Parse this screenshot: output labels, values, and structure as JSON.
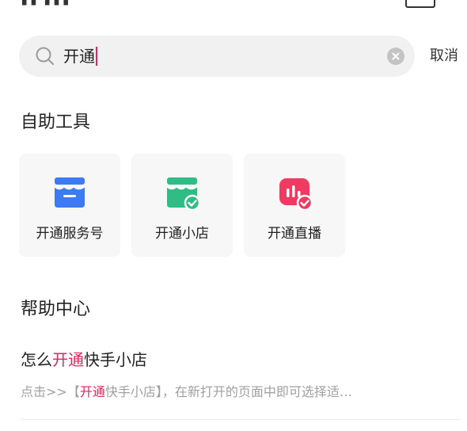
{
  "search": {
    "query": "开通",
    "cancel_label": "取消"
  },
  "tools": {
    "title": "自助工具",
    "items": [
      {
        "label": "开通服务号",
        "icon": "service-account-store-icon",
        "color": "#3d7bf5"
      },
      {
        "label": "开通小店",
        "icon": "store-check-icon",
        "color": "#2fbd85"
      },
      {
        "label": "开通直播",
        "icon": "live-check-icon",
        "color": "#f03a62"
      }
    ]
  },
  "help": {
    "title": "帮助中心",
    "article": {
      "title_before": "怎么",
      "title_highlight": "开通",
      "title_after": "快手小店",
      "desc_before": "点击>>【",
      "desc_highlight": "开通",
      "desc_after": "快手小店】，在新打开的页面中即可选择适…"
    }
  },
  "colors": {
    "highlight": "#e0245e",
    "muted_text": "#a0a0a0"
  }
}
